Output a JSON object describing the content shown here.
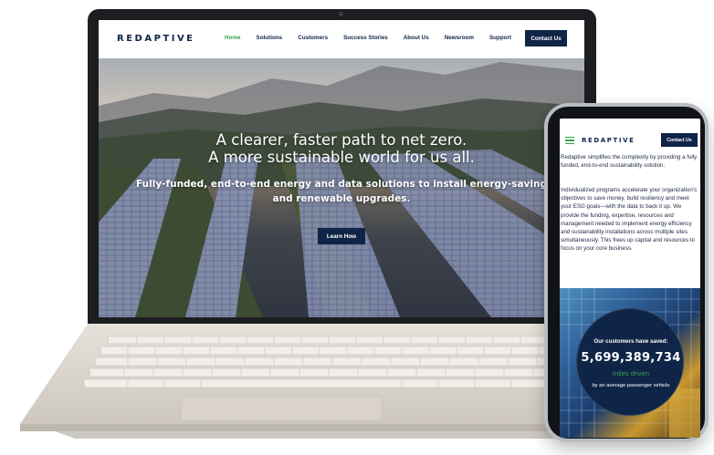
{
  "brand": {
    "logo": "REDAPTIVE",
    "navy": "#0f2547",
    "green": "#3aa04b"
  },
  "desktop": {
    "nav": {
      "links": [
        {
          "label": "Home",
          "active": true
        },
        {
          "label": "Solutions"
        },
        {
          "label": "Customers"
        },
        {
          "label": "Success Stories"
        },
        {
          "label": "About Us"
        },
        {
          "label": "Newsroom"
        },
        {
          "label": "Support"
        }
      ],
      "cta": "Contact Us"
    },
    "hero": {
      "title_line1": "A clearer, faster path to net zero.",
      "title_line2": "A more sustainable world for us all.",
      "subtitle": "Fully-funded, end-to-end energy and data solutions to install energy-saving and renewable upgrades.",
      "button": "Learn How"
    }
  },
  "mobile": {
    "nav": {
      "logo": "REDAPTIVE",
      "cta": "Contact Us",
      "menu_icon": "hamburger-icon"
    },
    "intro": "Redaptive simplifies the complexity by providing a fully funded, end-to-end sustainability solution.",
    "body": "Individualized programs accelerate your organization's objectives to save money, build resiliency and meet your ESG goals—with the data to back it up. We provide the funding, expertise, resources and management needed to implement energy efficiency and sustainability installations across multiple sites simultaneously. This frees up capital and resources to focus on your core business.",
    "stat": {
      "label": "Our customers have saved:",
      "value": "5,699,389,734",
      "unit": "miles driven",
      "note": "by an average passenger vehicle"
    }
  }
}
